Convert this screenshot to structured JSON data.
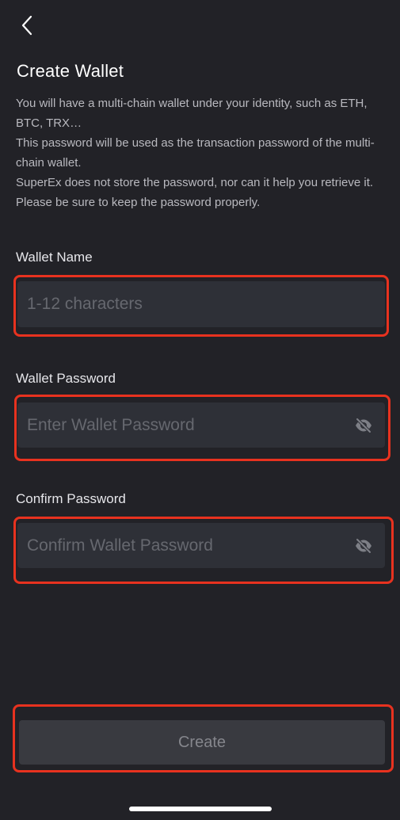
{
  "header": {
    "back_icon": "chevron-left-icon",
    "title": "Create Wallet"
  },
  "description": {
    "line1": "You will have a multi-chain wallet under your identity, such as ETH, BTC, TRX…",
    "line2": "This password will be used as the transaction password of the multi-chain wallet.",
    "line3": "SuperEx does not store the password, nor can it help you retrieve it. Please be sure to keep the password properly."
  },
  "form": {
    "wallet_name": {
      "label": "Wallet Name",
      "value": "",
      "placeholder": "1-12 characters"
    },
    "wallet_password": {
      "label": "Wallet Password",
      "value": "",
      "placeholder": "Enter Wallet Password",
      "toggle_icon": "eye-slash-icon"
    },
    "confirm_password": {
      "label": "Confirm Password",
      "value": "",
      "placeholder": "Confirm Wallet Password",
      "toggle_icon": "eye-slash-icon"
    }
  },
  "actions": {
    "create_label": "Create"
  },
  "colors": {
    "background": "#222227",
    "input_background": "#2e3037",
    "highlight": "#e8321f",
    "button_disabled": "#393a40"
  }
}
